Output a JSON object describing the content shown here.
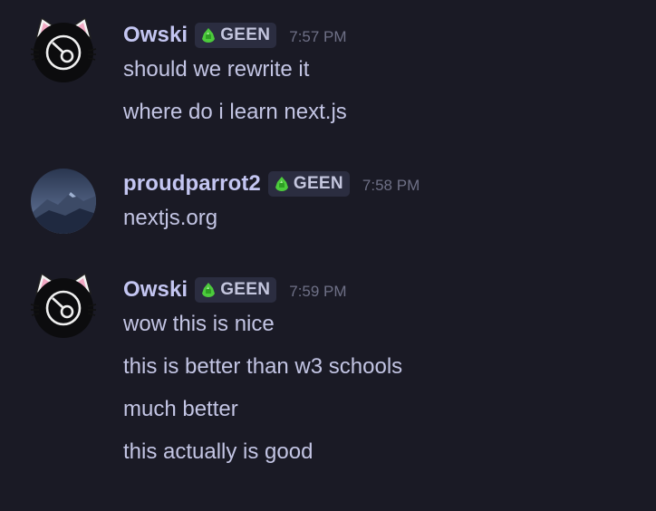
{
  "messages": [
    {
      "username": "Owski",
      "tag": "GEEN",
      "timestamp": "7:57 PM",
      "avatar": "cat-ear-avatar",
      "lines": [
        "should we rewrite it",
        "where do i learn next.js"
      ]
    },
    {
      "username": "proudparrot2",
      "tag": "GEEN",
      "timestamp": "7:58 PM",
      "avatar": "mountain-avatar",
      "lines": [
        "nextjs.org"
      ]
    },
    {
      "username": "Owski",
      "tag": "GEEN",
      "timestamp": "7:59 PM",
      "avatar": "cat-ear-avatar",
      "lines": [
        "wow this is nice",
        "this is better than w3 schools",
        "much better",
        "this actually is good"
      ]
    }
  ],
  "colors": {
    "background": "#1a1a25",
    "username": "#c4c6f2",
    "text": "#c3c5e4",
    "tag_bg": "#2b2d40",
    "tag_icon": "#4ccb3c",
    "timestamp": "#6e7086"
  },
  "icons": {
    "tag_icon": "green-gem-icon"
  }
}
